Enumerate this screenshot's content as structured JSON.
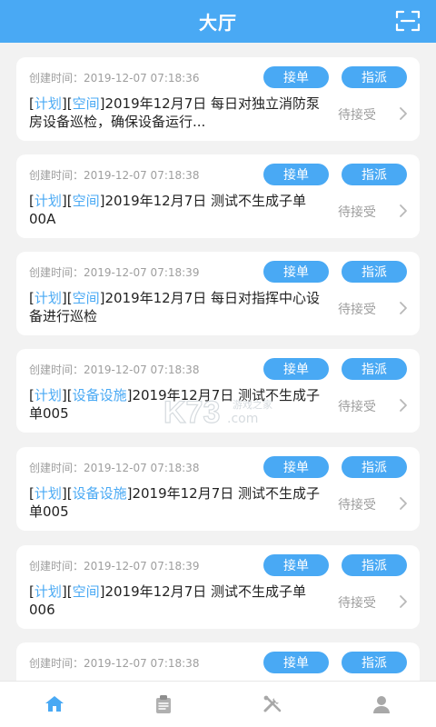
{
  "header": {
    "title": "大厅",
    "scan_icon": "scan-icon"
  },
  "colors": {
    "primary": "#49A9F4",
    "background": "#F2F2F2",
    "muted_text": "#9E9E9E"
  },
  "tasks": [
    {
      "created": "创建时间：2019-12-07 07:18:36",
      "tag1": "计划",
      "tag2": "空间",
      "text": "2019年12月7日 每日对独立消防泵房设备巡检，确保设备运行...",
      "status": "待接受",
      "accept_label": "接单",
      "assign_label": "指派"
    },
    {
      "created": "创建时间：2019-12-07 07:18:38",
      "tag1": "计划",
      "tag2": "空间",
      "text": "2019年12月7日 测试不生成子单00A",
      "status": "待接受",
      "accept_label": "接单",
      "assign_label": "指派"
    },
    {
      "created": "创建时间：2019-12-07 07:18:39",
      "tag1": "计划",
      "tag2": "空间",
      "text": "2019年12月7日 每日对指挥中心设备进行巡检",
      "status": "待接受",
      "accept_label": "接单",
      "assign_label": "指派"
    },
    {
      "created": "创建时间：2019-12-07 07:18:38",
      "tag1": "计划",
      "tag2": "设备设施",
      "text": "2019年12月7日 测试不生成子单005",
      "status": "待接受",
      "accept_label": "接单",
      "assign_label": "指派"
    },
    {
      "created": "创建时间：2019-12-07 07:18:38",
      "tag1": "计划",
      "tag2": "设备设施",
      "text": "2019年12月7日 测试不生成子单005",
      "status": "待接受",
      "accept_label": "接单",
      "assign_label": "指派"
    },
    {
      "created": "创建时间：2019-12-07 07:18:39",
      "tag1": "计划",
      "tag2": "空间",
      "text": "2019年12月7日 测试不生成子单006",
      "status": "待接受",
      "accept_label": "接单",
      "assign_label": "指派"
    },
    {
      "created": "创建时间：2019-12-07 07:18:38",
      "tag1": "",
      "tag2": "",
      "text": "",
      "status": "",
      "accept_label": "接单",
      "assign_label": "指派"
    }
  ],
  "watermark": {
    "logo_text": "K73",
    "subtext": "游戏之家",
    "domain": ".com"
  },
  "bottom_nav": [
    {
      "icon": "home-icon",
      "active": true
    },
    {
      "icon": "clipboard-icon",
      "active": false
    },
    {
      "icon": "tools-icon",
      "active": false
    },
    {
      "icon": "user-icon",
      "active": false
    }
  ]
}
